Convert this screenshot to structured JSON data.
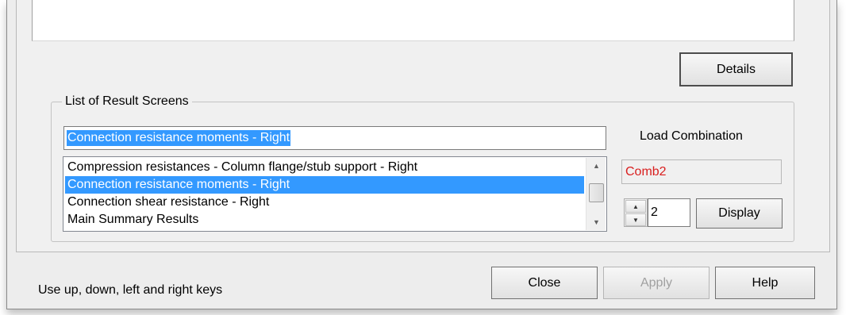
{
  "top_panel": {
    "details_button": "Details"
  },
  "result_screens": {
    "group_title": "List of Result Screens",
    "selected_value": "Connection resistance moments - Right",
    "items": [
      {
        "label": "Compression resistances - Column flange/stub support - Right",
        "selected": false
      },
      {
        "label": "Connection resistance moments - Right",
        "selected": true
      },
      {
        "label": "Connection shear resistance - Right",
        "selected": false
      },
      {
        "label": "Main Summary Results",
        "selected": false
      }
    ]
  },
  "load_combination": {
    "label": "Load Combination",
    "value": "Comb2",
    "value_color": "#d91e1e",
    "number": "2",
    "display_button": "Display"
  },
  "footer": {
    "status": "Use up, down, left and right keys",
    "close_button": "Close",
    "apply_button": "Apply",
    "help_button": "Help"
  },
  "colors": {
    "selection": "#3399ff",
    "window_bg": "#f0f0f0"
  },
  "icons": [
    "scroll-up-arrow-icon",
    "scroll-down-arrow-icon",
    "spin-up-icon",
    "spin-down-icon"
  ]
}
